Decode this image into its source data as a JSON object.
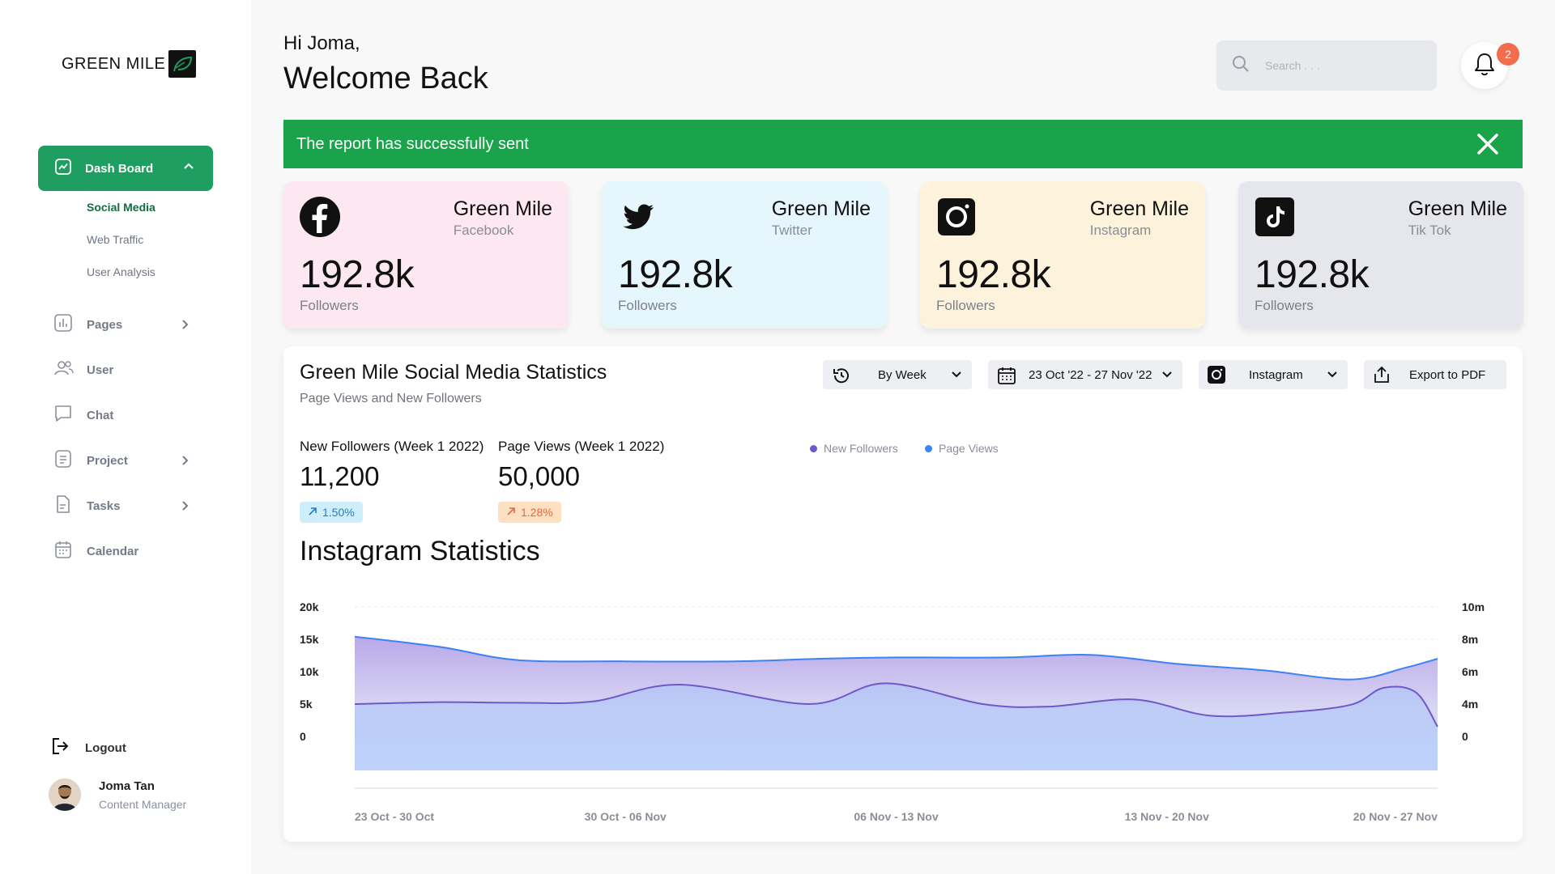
{
  "app": {
    "logo_text": "GREEN MILE"
  },
  "sidebar": {
    "active": {
      "label": "Dash Board"
    },
    "sub_items": [
      {
        "label": "Social Media"
      },
      {
        "label": "Web Traffic"
      },
      {
        "label": "User Analysis"
      }
    ],
    "items": [
      {
        "label": "Pages"
      },
      {
        "label": "User"
      },
      {
        "label": "Chat"
      },
      {
        "label": "Project"
      },
      {
        "label": "Tasks"
      },
      {
        "label": "Calendar"
      }
    ],
    "logout_label": "Logout",
    "profile": {
      "name": "Joma Tan",
      "role": "Content Manager"
    }
  },
  "header": {
    "greeting": "Hi Joma,",
    "welcome": "Welcome Back",
    "search_placeholder": "Search . . .",
    "notification_count": "2"
  },
  "banner": {
    "message": "The report has successfully sent"
  },
  "cards": [
    {
      "title": "Green Mile",
      "platform": "Facebook",
      "count": "192.8k",
      "unit": "Followers",
      "bg": "#fde7f0"
    },
    {
      "title": "Green Mile",
      "platform": "Twitter",
      "count": "192.8k",
      "unit": "Followers",
      "bg": "#e5f6fd"
    },
    {
      "title": "Green Mile",
      "platform": "Instagram",
      "count": "192.8k",
      "unit": "Followers",
      "bg": "#fdf2dc"
    },
    {
      "title": "Green Mile",
      "platform": "Tik Tok",
      "count": "192.8k",
      "unit": "Followers",
      "bg": "#e6e7ec"
    }
  ],
  "stats": {
    "title": "Green Mile Social Media Statistics",
    "subtitle": "Page Views and New Followers",
    "controls": {
      "period": "By Week",
      "date_range": "23 Oct '22 - 27 Nov '22",
      "platform": "Instagram",
      "export": "Export to PDF"
    },
    "metrics": [
      {
        "label": "New Followers (Week 1 2022)",
        "value": "11,200",
        "change": "1.50%"
      },
      {
        "label": "Page Views (Week 1 2022)",
        "value": "50,000",
        "change": "1.28%"
      }
    ],
    "chart_heading": "Instagram Statistics"
  },
  "colors": {
    "accent": "#1e9e61",
    "banner": "#1aa34a",
    "new_followers": "#6f58c9",
    "page_views": "#3b82f6"
  },
  "chart_data": {
    "type": "area",
    "x": [
      "23 Oct - 30 Oct",
      "30 Oct - 06 Nov",
      "06 Nov - 13 Nov",
      "13 Nov - 20 Nov",
      "20 Nov - 27 Nov"
    ],
    "left_axis": {
      "ticks": [
        "20k",
        "15k",
        "10k",
        "5k",
        "0"
      ],
      "ylim": [
        0,
        20000
      ]
    },
    "right_axis": {
      "ticks": [
        "10m",
        "8m",
        "6m",
        "4m",
        "0"
      ],
      "ylim": [
        0,
        10000000
      ]
    },
    "series": [
      {
        "name": "New Followers",
        "axis": "left",
        "x": [
          0,
          0.08,
          0.15,
          0.22,
          0.3,
          0.42,
          0.49,
          0.58,
          0.64,
          0.72,
          0.79,
          0.86,
          0.92,
          0.95,
          0.98,
          1
        ],
        "values": [
          5000,
          5300,
          5200,
          5400,
          8000,
          5000,
          8200,
          5000,
          4600,
          5700,
          3200,
          3700,
          4900,
          7500,
          6800,
          1500
        ]
      },
      {
        "name": "Page Views",
        "axis": "right",
        "x": [
          0,
          0.08,
          0.15,
          0.25,
          0.35,
          0.43,
          0.5,
          0.6,
          0.68,
          0.76,
          0.84,
          0.92,
          0.97,
          1
        ],
        "values": [
          7700000,
          6900000,
          5900000,
          5800000,
          5800000,
          6000000,
          6100000,
          6100000,
          6300000,
          5600000,
          5100000,
          4400000,
          5300000,
          6000000
        ]
      }
    ]
  }
}
